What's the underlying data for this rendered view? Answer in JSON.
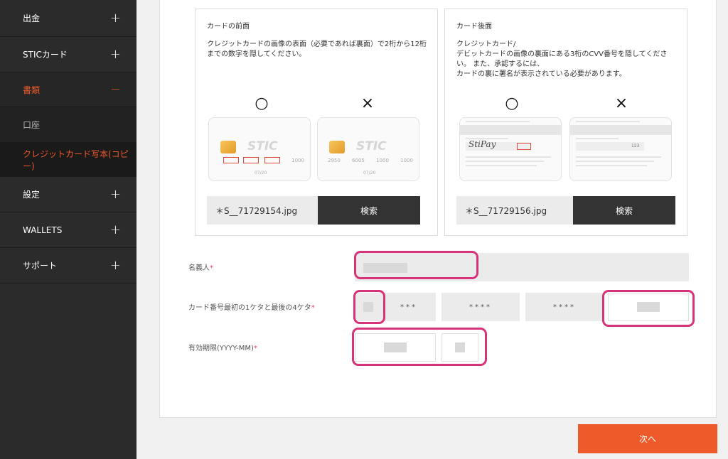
{
  "sidebar": {
    "items": [
      {
        "label": "出金",
        "sign": "+"
      },
      {
        "label": "STICカード",
        "sign": "+"
      },
      {
        "label": "書類",
        "sign": "−"
      },
      {
        "label": "設定",
        "sign": "+"
      },
      {
        "label": "WALLETS",
        "sign": "+"
      },
      {
        "label": "サポート",
        "sign": "+"
      }
    ],
    "sub_items": [
      {
        "label": "口座"
      },
      {
        "label": "クレジットカード写本(コピー)"
      }
    ]
  },
  "front_box": {
    "title": "カードの前面",
    "description": "クレジットカードの画像の表面（必要であれば裏面）で2桁から12桁までの数字を隠してください。",
    "ok_mark": "○",
    "ng_mark": "×",
    "card_brand": "STIC",
    "ok_numbers": [
      "",
      "",
      "",
      "1000"
    ],
    "ng_numbers": [
      "2950",
      "6005",
      "1000",
      "1000"
    ],
    "expiry": "07/20",
    "file_name": "＊S__71729154.jpg",
    "search_label": "検索"
  },
  "back_box": {
    "title": "カード後面",
    "description": "クレジットカード/\nデビットカードの画像の裏面にある3桁のCVV番号を隠してください。 また、承認するには、\nカードの裏に署名が表示されている必要があります。",
    "ok_mark": "○",
    "ng_mark": "×",
    "signature": "StiPay",
    "cvv": "123",
    "file_name": "＊S__71729156.jpg",
    "search_label": "検索"
  },
  "form": {
    "name_label": "名義人",
    "card_number_label": "カード番号最初の1ケタと最後の4ケタ",
    "expiry_label": "有効期限(YYYY-MM)",
    "required_mark": "*",
    "mask_3": "***",
    "mask_4": "****"
  },
  "next_label": "次へ",
  "colors": {
    "accent": "#ef5a2a",
    "highlight": "#d6337a",
    "sidebar_bg": "#2b2b2b"
  }
}
